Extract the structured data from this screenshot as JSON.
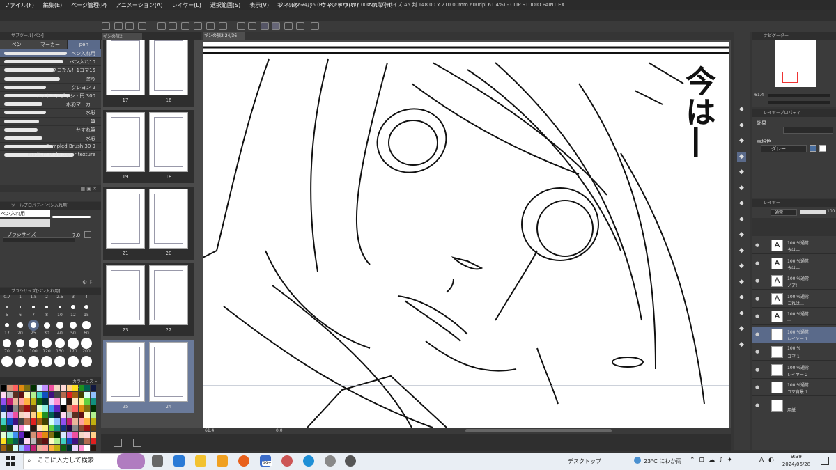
{
  "menubar": {
    "items": [
      "ファイル(F)",
      "編集(E)",
      "ページ管理(P)",
      "アニメーション(A)",
      "レイヤー(L)",
      "選択範囲(S)",
      "表示(V)",
      "フィルター(I)",
      "ウィンドウ(W)",
      "ヘルプ(H)"
    ],
    "title": "ギンの旅2 24/36 (B5 182.00 x 257.00mm 製本サイズ:A5 判 148.00 x 210.00mm 600dpi 61.4%) - CLIP STUDIO PAINT EX"
  },
  "doc_tabs": {
    "left": "ギンの旅2",
    "main": "ギンの旅2 24/36"
  },
  "subtool": {
    "header": "サブツール[ペン]",
    "tabs": [
      "ペン",
      "マーカー",
      "pen"
    ],
    "brushes": [
      {
        "label": "ペン入れ用",
        "selected": true
      },
      {
        "label": "ペン入れ10"
      },
      {
        "label": "ネコたん！1コマ15"
      },
      {
        "label": "塗り"
      },
      {
        "label": "クレヨン 2"
      },
      {
        "label": "ソフトエアブラシ - 円 300"
      },
      {
        "label": "水彩マーカー"
      },
      {
        "label": "水彩"
      },
      {
        "label": "筆"
      },
      {
        "label": "かすれ筆"
      },
      {
        "label": "水彩"
      },
      {
        "label": "Sampled Brush 30 9"
      },
      {
        "label": "medium wide paper texture"
      }
    ]
  },
  "tool_property": {
    "header": "ツールプロパティ[ペン入れ用]",
    "name": "ペン入れ用",
    "brush_size_label": "ブラシサイズ",
    "brush_size_value": "7.0"
  },
  "brush_size": {
    "header": "ブラシサイズ[ペン入れ用]",
    "sizes": [
      "0.7",
      "1",
      "1.5",
      "2",
      "2.5",
      "3",
      "4",
      "5",
      "6",
      "7",
      "8",
      "10",
      "12",
      "15",
      "17",
      "20",
      "25",
      "30",
      "40",
      "50",
      "60",
      "70",
      "80",
      "100",
      "120",
      "150",
      "170",
      "200"
    ],
    "selected": "7"
  },
  "color_history_label": "カラーヒストリー",
  "pages": [
    {
      "left": "17",
      "right": "16"
    },
    {
      "left": "19",
      "right": "18"
    },
    {
      "left": "21",
      "right": "20"
    },
    {
      "left": "23",
      "right": "22"
    },
    {
      "left": "25",
      "right": "24",
      "selected": true
    }
  ],
  "canvas": {
    "text": "今は―",
    "zoom": "61.4",
    "angle": "0.0"
  },
  "navigator": {
    "header": "ナビゲーター",
    "zoom": "61.4"
  },
  "layer_property": {
    "header": "レイヤープロパティ",
    "effect_label": "効果",
    "expression_color_label": "表現色",
    "expression_color_value": "グレー"
  },
  "layers": {
    "header": "レイヤー",
    "blend_mode": "通常",
    "opacity": "100",
    "rows": [
      {
        "l1": "100 %通常",
        "l2": "今は—",
        "kind": "text"
      },
      {
        "l1": "100 %通常",
        "l2": "今は—",
        "kind": "text"
      },
      {
        "l1": "100 %通常",
        "l2": "ノア!",
        "kind": "text"
      },
      {
        "l1": "100 %通常",
        "l2": "これは…",
        "kind": "text"
      },
      {
        "l1": "100 %通常",
        "l2": "…",
        "kind": "text"
      },
      {
        "l1": "100 %通常",
        "l2": "レイヤー 1",
        "kind": "raster",
        "selected": true
      },
      {
        "l1": "100 %",
        "l2": "コマ 1",
        "kind": "folder"
      },
      {
        "l1": "100 %通常",
        "l2": "レイヤー 2",
        "kind": "raster"
      },
      {
        "l1": "100 %通常",
        "l2": "コマ背景 1",
        "kind": "raster"
      },
      {
        "l1": "",
        "l2": "用紙",
        "kind": "paper"
      }
    ]
  },
  "taskbar": {
    "search_placeholder": "ここに入力して検索",
    "desktop_label": "デスクトップ",
    "weather": "23°C にわか雨",
    "time": "9:39",
    "date": "2024/06/28",
    "ime": "A",
    "badge": "99+"
  }
}
